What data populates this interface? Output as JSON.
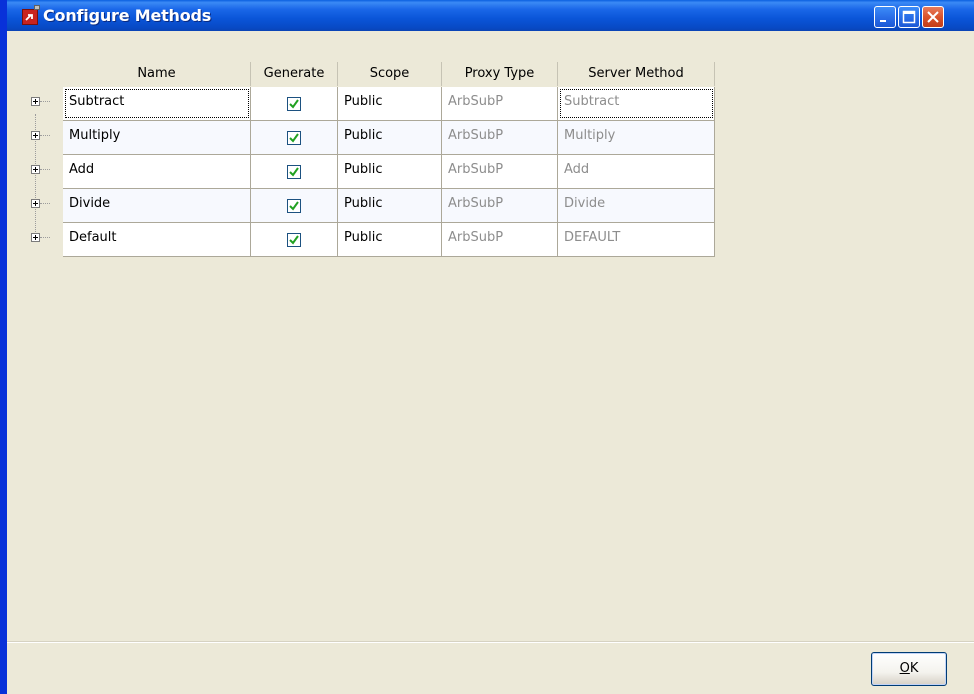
{
  "window": {
    "title": "Configure Methods"
  },
  "titlebar_buttons": {
    "minimize": "minimize-icon",
    "maximize": "maximize-icon",
    "close": "close-icon"
  },
  "grid": {
    "columns": [
      "Name",
      "Generate",
      "Scope",
      "Proxy Type",
      "Server Method"
    ],
    "rows": [
      {
        "name": "Subtract",
        "generate": true,
        "scope": "Public",
        "proxy_type": "ArbSubP",
        "server_method": "Subtract"
      },
      {
        "name": "Multiply",
        "generate": true,
        "scope": "Public",
        "proxy_type": "ArbSubP",
        "server_method": "Multiply"
      },
      {
        "name": "Add",
        "generate": true,
        "scope": "Public",
        "proxy_type": "ArbSubP",
        "server_method": "Add"
      },
      {
        "name": "Divide",
        "generate": true,
        "scope": "Public",
        "proxy_type": "ArbSubP",
        "server_method": "Divide"
      },
      {
        "name": "Default",
        "generate": true,
        "scope": "Public",
        "proxy_type": "ArbSubP",
        "server_method": "DEFAULT"
      }
    ],
    "selected_row": 0
  },
  "footer": {
    "ok_label_mnemonic": "O",
    "ok_label_rest": "K"
  },
  "colors": {
    "title_bar": "#0a55d8",
    "window_bg": "#ece9d8",
    "check_mark": "#21a121"
  }
}
